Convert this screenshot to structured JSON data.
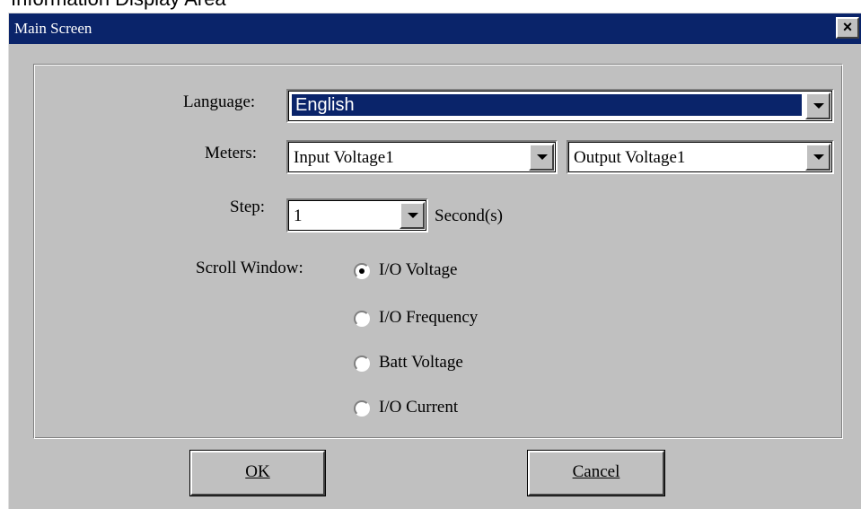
{
  "page_caption": "Information Display Area",
  "window": {
    "title": "Main Screen",
    "close_glyph": "×"
  },
  "form": {
    "language": {
      "label": "Language:",
      "value": "English"
    },
    "meters": {
      "label": "Meters:",
      "input_value": "Input Voltage1",
      "output_value": "Output Voltage1"
    },
    "step": {
      "label": "Step:",
      "value": "1",
      "unit": "Second(s)"
    },
    "scroll_window": {
      "label": "Scroll Window:",
      "options": [
        "I/O Voltage",
        "I/O Frequency",
        "Batt Voltage",
        "I/O Current"
      ],
      "selected": "I/O Voltage"
    }
  },
  "buttons": {
    "ok_label": "OK",
    "cancel_label": "Cancel"
  }
}
